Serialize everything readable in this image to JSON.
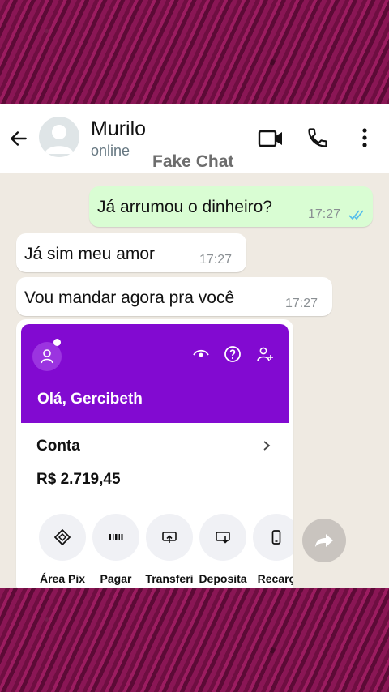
{
  "header": {
    "contact_name": "Murilo",
    "status": "online",
    "watermark": "Fake Chat"
  },
  "messages": [
    {
      "direction": "outgoing",
      "text": "Já arrumou o dinheiro?",
      "time": "17:27",
      "status": "read"
    },
    {
      "direction": "incoming",
      "text": "Já sim meu amor",
      "time": "17:27"
    },
    {
      "direction": "incoming",
      "text": "Vou mandar agora pra você",
      "time": "17:27"
    }
  ],
  "shared_image": {
    "greeting": "Olá, Gercibeth",
    "account_label": "Conta",
    "balance": "R$ 2.719,45",
    "actions": [
      {
        "label": "Área Pix",
        "icon": "pix-icon"
      },
      {
        "label": "Pagar",
        "icon": "barcode-icon"
      },
      {
        "label": "Transferi",
        "icon": "transfer-icon"
      },
      {
        "label": "Deposita",
        "icon": "deposit-icon"
      },
      {
        "label": "Recarç",
        "icon": "phone-recharge-icon"
      }
    ],
    "accent_color": "#820ad1"
  },
  "colors": {
    "outgoing_bubble": "#d9fdd3",
    "incoming_bubble": "#ffffff",
    "chat_background": "#efeae2",
    "frame_background": "#7a1048",
    "read_ticks": "#53bdeb"
  }
}
